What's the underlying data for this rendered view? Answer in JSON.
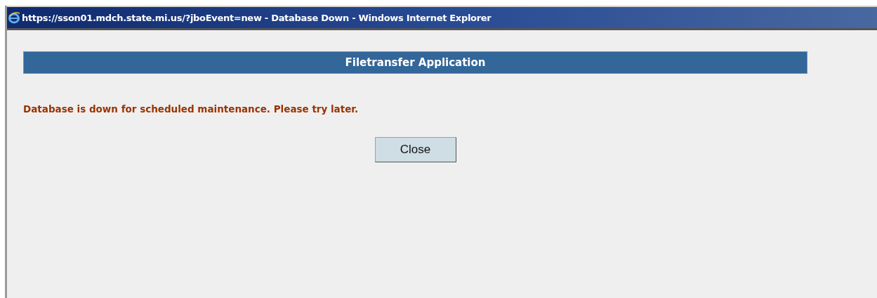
{
  "window": {
    "title": "https://sson01.mdch.state.mi.us/?jboEvent=new - Database Down - Windows Internet Explorer"
  },
  "header": {
    "title": "Filetransfer Application"
  },
  "message": "Database is down for scheduled maintenance. Please try later.",
  "buttons": [
    {
      "label": "Close"
    }
  ]
}
